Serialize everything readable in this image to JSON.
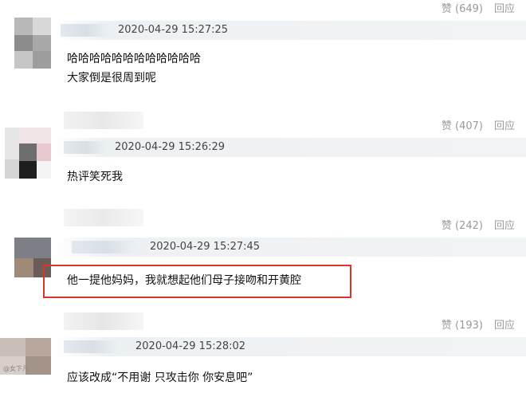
{
  "comments": [
    {
      "likes": "赞 (649)",
      "reply": "回应",
      "timestamp": "2020-04-29 15:27:25",
      "lines": [
        "哈哈哈哈哈哈哈哈哈哈哈哈",
        "大家倒是很周到呢"
      ]
    },
    {
      "likes": "赞 (407)",
      "reply": "回应",
      "timestamp": "2020-04-29 15:26:29",
      "lines": [
        "热评笑死我"
      ]
    },
    {
      "likes": "赞 (242)",
      "reply": "回应",
      "timestamp": "2020-04-29 15:27:45",
      "lines": [
        "他一提他妈妈，我就想起他们母子接吻和开黄腔"
      ]
    },
    {
      "likes": "赞 (193)",
      "reply": "回应",
      "timestamp": "2020-04-29 15:28:02",
      "lines": [
        "应该改成“不用谢 只攻击你 你安息吧”"
      ]
    }
  ],
  "colors": {
    "highlight_border": "#d9362b",
    "meta_background": "#f1f4f5",
    "action_text": "#9a9a9a"
  },
  "watermark_text": "@女下凡"
}
